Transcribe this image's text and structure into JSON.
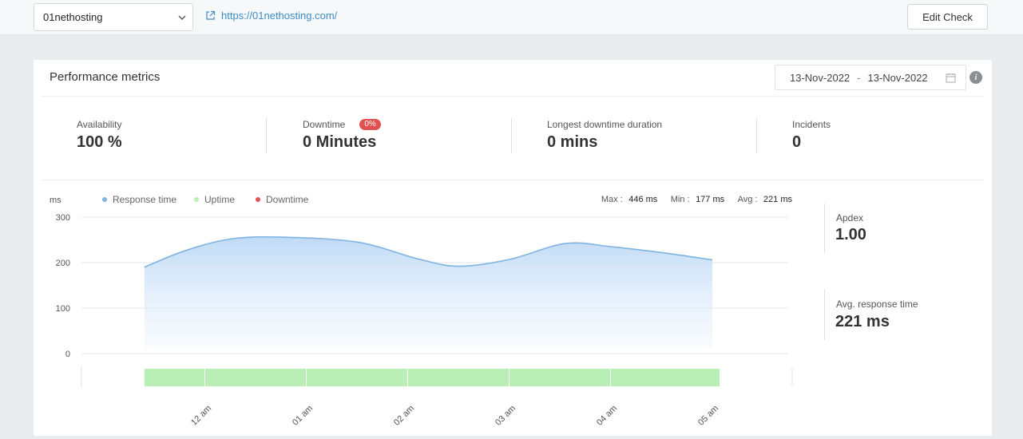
{
  "topbar": {
    "site_select_value": "01nethosting",
    "site_url": "https://01nethosting.com/",
    "edit_button": "Edit Check"
  },
  "card": {
    "title": "Performance metrics",
    "date_from": "13-Nov-2022",
    "date_separator": "-",
    "date_to": "13-Nov-2022",
    "info_icon": "i"
  },
  "stats": {
    "availability": {
      "label": "Availability",
      "value": "100 %"
    },
    "downtime": {
      "label": "Downtime",
      "badge": "0%",
      "value": "0 Minutes"
    },
    "longest": {
      "label": "Longest downtime duration",
      "value": "0 mins"
    },
    "incidents": {
      "label": "Incidents",
      "value": "0"
    }
  },
  "side": {
    "apdex": {
      "label": "Apdex",
      "value": "1.00"
    },
    "avg_response": {
      "label": "Avg. response time",
      "value": "221 ms"
    }
  },
  "colors": {
    "response": "#7fb3e0",
    "uptime": "#b9efb4",
    "downtime": "#e05252",
    "link": "#3a8dc6"
  },
  "chart_data": {
    "type": "area",
    "ylabel": "ms",
    "ylim": [
      0,
      300
    ],
    "y_ticks": [
      "300",
      "200",
      "100",
      "0"
    ],
    "legend": [
      {
        "name": "Response time",
        "color": "#7fb3e0"
      },
      {
        "name": "Uptime",
        "color": "#b9efb4"
      },
      {
        "name": "Downtime",
        "color": "#e05252"
      }
    ],
    "summary": {
      "max_label": "Max :",
      "max_value": "446 ms",
      "min_label": "Min :",
      "min_value": "177 ms",
      "avg_label": "Avg :",
      "avg_value": "221 ms"
    },
    "x_ticks": [
      "12 am",
      "01 am",
      "02 am",
      "03 am",
      "04 am",
      "05 am"
    ],
    "x_tick_hours": [
      0,
      1,
      2,
      3,
      4,
      5
    ],
    "x_range_hours": [
      -0.6,
      5.6
    ],
    "series": [
      {
        "name": "Response time",
        "x_hours": [
          -0.6,
          -0.2,
          0.25,
          0.75,
          1.5,
          2.1,
          2.5,
          3.0,
          3.55,
          4.0,
          4.5,
          5.0
        ],
        "values": [
          190,
          226,
          252,
          256,
          245,
          208,
          192,
          207,
          242,
          235,
          222,
          206
        ]
      }
    ],
    "uptime_segments": [
      {
        "start_hour": -0.6,
        "end_hour": 0.0
      },
      {
        "start_hour": 0.0,
        "end_hour": 1.0
      },
      {
        "start_hour": 1.0,
        "end_hour": 2.0
      },
      {
        "start_hour": 2.0,
        "end_hour": 3.0
      },
      {
        "start_hour": 3.0,
        "end_hour": 4.0
      },
      {
        "start_hour": 4.0,
        "end_hour": 5.0
      }
    ],
    "uptime_end_hour": 5.0,
    "grid": true
  }
}
